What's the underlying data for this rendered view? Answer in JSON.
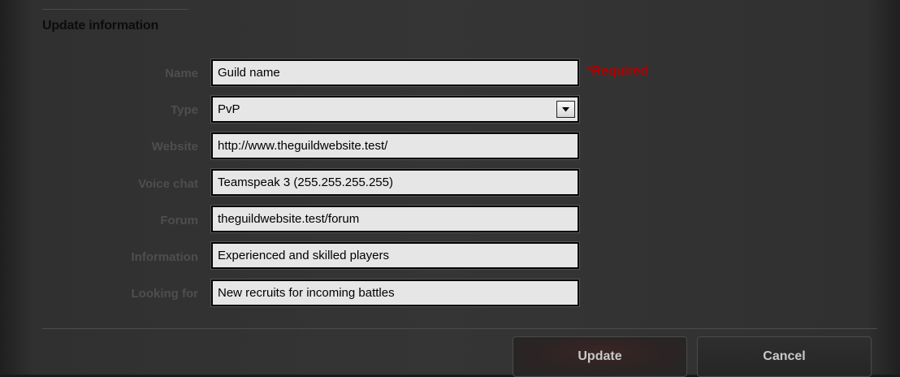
{
  "section": {
    "title": "Update information"
  },
  "form": {
    "fields": [
      {
        "label": "Name",
        "value": "Guild name"
      },
      {
        "label": "Type",
        "value": "PvP"
      },
      {
        "label": "Website",
        "value": "http://www.theguildwebsite.test/"
      },
      {
        "label": "Voice chat",
        "value": "Teamspeak 3 (255.255.255.255)"
      },
      {
        "label": "Forum",
        "value": "theguildwebsite.test/forum"
      },
      {
        "label": "Information",
        "value": "Experienced and skilled players"
      },
      {
        "label": "Looking for",
        "value": "New recruits for incoming battles"
      }
    ],
    "required_note": "*Required"
  },
  "buttons": {
    "update_label": "Update",
    "cancel_label": "Cancel"
  },
  "colors": {
    "required": "#b00000",
    "label": "#4e4e4e",
    "field_bg": "#e6e6e6"
  },
  "icons": {
    "select_arrow": "triangle-down"
  }
}
